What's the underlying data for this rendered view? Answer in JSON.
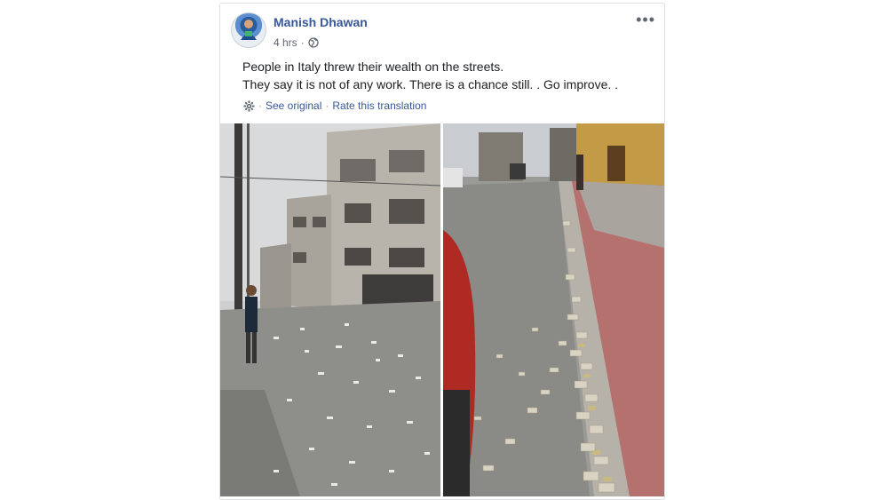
{
  "post": {
    "author": "Manish Dhawan",
    "time": "4 hrs",
    "separator": "·",
    "text_line1": "People in Italy threw their wealth on the streets.",
    "text_line2": "They say it is not of any work. There is a chance still. . Go improve. .",
    "see_original": "See original",
    "rate_translation": "Rate this translation",
    "more_menu": "•••"
  },
  "icons": {
    "privacy": "globe-icon",
    "settings": "gear-icon",
    "more": "more-options-icon"
  },
  "colors": {
    "link": "#385898",
    "meta": "#616770",
    "text": "#1c1e21"
  }
}
